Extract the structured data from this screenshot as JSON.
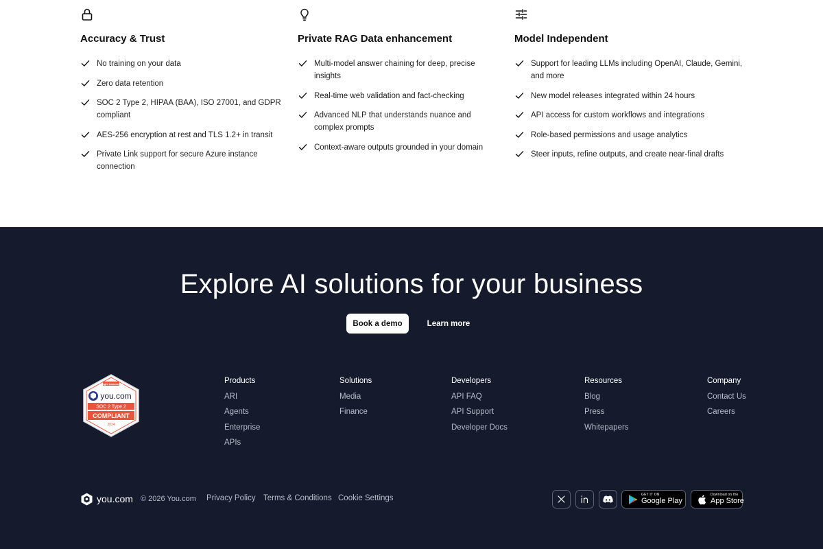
{
  "features": {
    "columns": [
      {
        "icon": "lock-icon",
        "title": "Accuracy & Trust",
        "items": [
          "No training on your data",
          "Zero data retention",
          "SOC 2 Type 2, HIPAA (BAA), ISO 27001, and GDPR compliant",
          "AES-256 encryption at rest and TLS 1.2+ in transit",
          "Private Link support for secure Azure instance connection"
        ]
      },
      {
        "icon": "lightbulb-icon",
        "title": "Private RAG Data enhancement",
        "items": [
          "Multi-model answer chaining for deep, precise insights",
          "Real-time web validation and fact-checking",
          "Advanced NLP that understands nuance and complex prompts",
          "Context-aware outputs grounded in your domain"
        ]
      },
      {
        "icon": "sliders-icon",
        "title": "Model Independent",
        "items": [
          "Support for leading LLMs including OpenAI, Claude, Gemini, and more",
          "New model releases integrated within 24 hours",
          "API access for custom workflows and integrations",
          "Role-based permissions and usage analytics",
          "Steer inputs, refine outputs, and create near-final drafts"
        ]
      }
    ]
  },
  "cta": {
    "title": "Explore AI solutions for your business",
    "primary_button": "Book a demo",
    "secondary_button": "Learn more"
  },
  "badge": {
    "top_text": "Insight Assurance",
    "brand": "you.com",
    "type": "SOC 2 Type 2",
    "status": "COMPLIANT",
    "year": "2024"
  },
  "footer": {
    "columns": [
      {
        "heading": "Products",
        "links": [
          "ARI",
          "Agents",
          "Enterprise",
          "APIs"
        ]
      },
      {
        "heading": "Solutions",
        "links": [
          "Media",
          "Finance"
        ]
      },
      {
        "heading": "Developers",
        "links": [
          "API FAQ",
          "API Support",
          "Developer Docs"
        ]
      },
      {
        "heading": "Resources",
        "links": [
          "Blog",
          "Press",
          "Whitepapers"
        ]
      },
      {
        "heading": "Company",
        "links": [
          "Contact Us",
          "Careers"
        ]
      }
    ],
    "brand": "you.com",
    "copyright": "© 2026 You.com",
    "links": {
      "privacy": "Privacy Policy",
      "terms": "Terms & Conditions",
      "cookie": "Cookie Settings"
    },
    "social": [
      "x-icon",
      "linkedin-icon",
      "discord-icon"
    ],
    "google_play": {
      "small": "GET IT ON",
      "big": "Google Play"
    },
    "app_store": {
      "small": "Download on the",
      "big": "App Store"
    }
  },
  "colors": {
    "dark_background": "#151a2d",
    "badge_orange": "#e8553a",
    "badge_blue": "#2b3b8f"
  }
}
